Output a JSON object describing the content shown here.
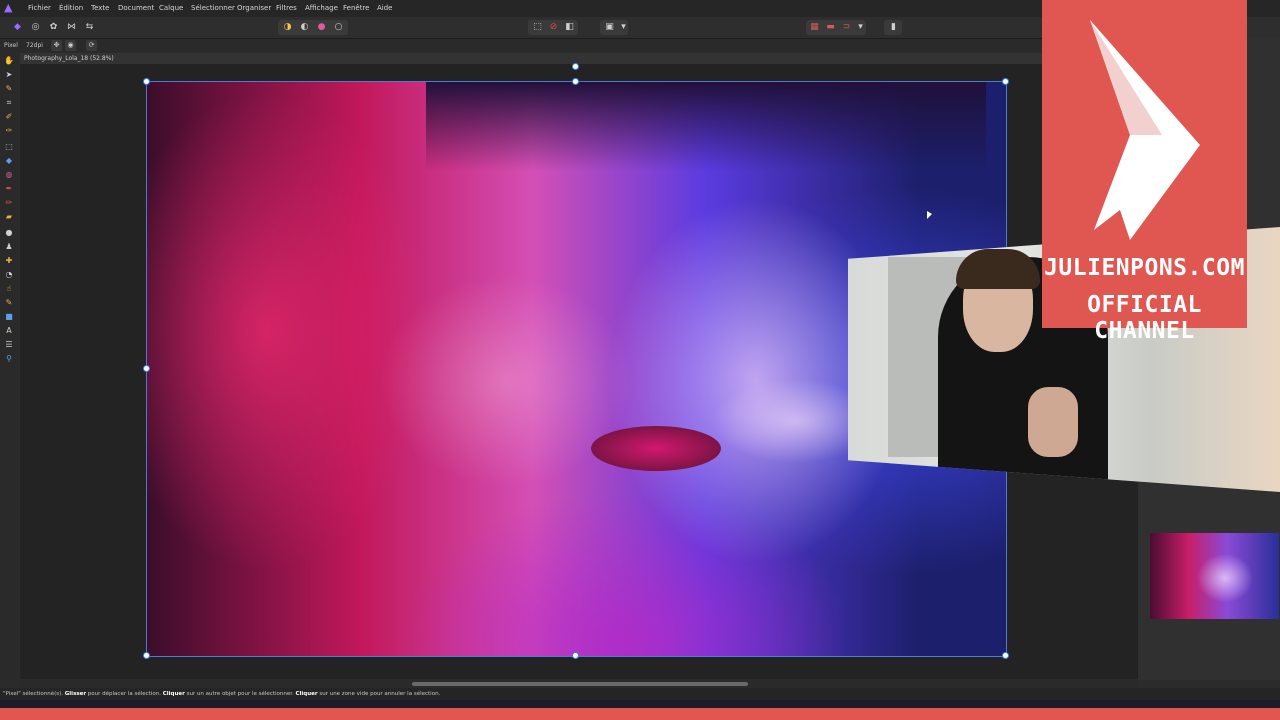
{
  "menu": [
    "Fichier",
    "Édition",
    "Texte",
    "Document",
    "Calque",
    "Sélectionner",
    "Organiser",
    "Filtres",
    "Affichage",
    "Fenêtre",
    "Aide"
  ],
  "context": {
    "unit": "Pixel",
    "dpi": "72dpi"
  },
  "document": {
    "title": "Photography_Lola_18 (52.8%)"
  },
  "brand": {
    "line1": "JULIENPONS.COM",
    "line2": "OFFICIAL CHANNEL",
    "color": "#e05650"
  },
  "status": {
    "p1": "\"Pixel\" sélectionné(s). ",
    "b1": "Glisser",
    "p2": " pour déplacer la sélection. ",
    "b2": "Cliquer",
    "p3": " sur un autre objet pour le sélectionner. ",
    "b3": "Cliquer",
    "p4": " sur une zone vide pour annuler la sélection."
  },
  "colors": {
    "accent": "#4a7bd8",
    "app_bg": "#2b2b2b",
    "logo": "#9b6bff"
  },
  "icons": [
    "affinity-logo-icon",
    "move-tool-icon",
    "crop-tool-icon",
    "brush-tool-icon",
    "selection-tool-icon",
    "text-tool-icon",
    "zoom-tool-icon"
  ]
}
